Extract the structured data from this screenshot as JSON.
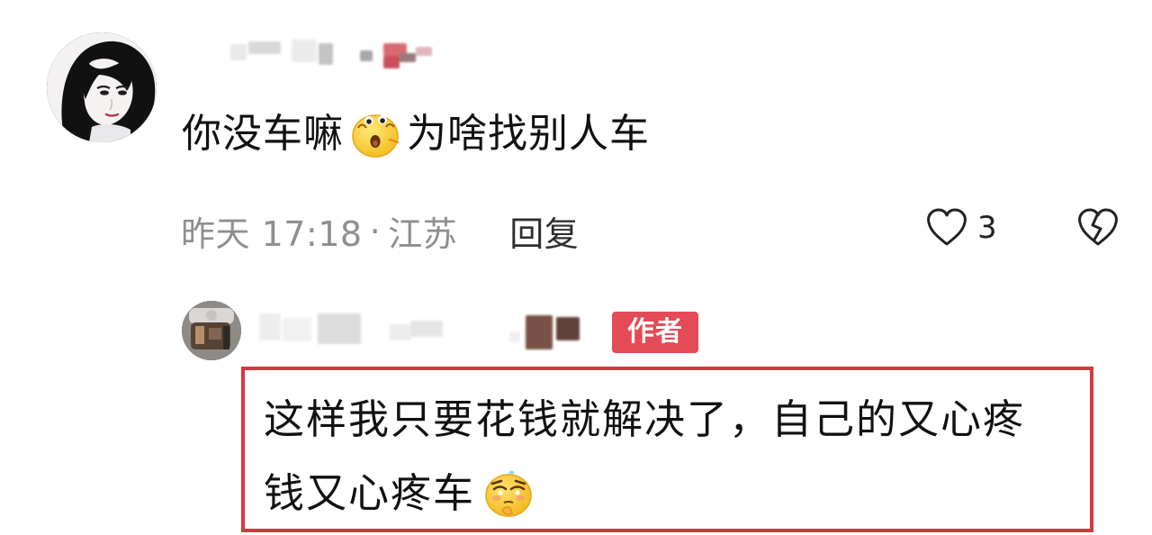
{
  "comment": {
    "text_before_emoji": "你没车嘛",
    "text_after_emoji": "为啥找别人车",
    "timestamp": "昨天 17:18",
    "separator": "·",
    "location": "江苏",
    "reply_label": "回复",
    "like_count": "3"
  },
  "reply": {
    "author_badge": "作者",
    "text_line_1": "这样我只要花钱就解决了，自己的又心疼",
    "text_line_2": "钱又心疼车"
  },
  "icons": {
    "comment_emoji": "shocked-emoji",
    "like": "heart-outline-icon",
    "dislike": "broken-heart-icon",
    "reply_emoji": "sweat-shy-emoji"
  },
  "colors": {
    "badge": "#e34b57",
    "highlight_border": "#d7383d",
    "meta_text": "#8f8f8f"
  }
}
